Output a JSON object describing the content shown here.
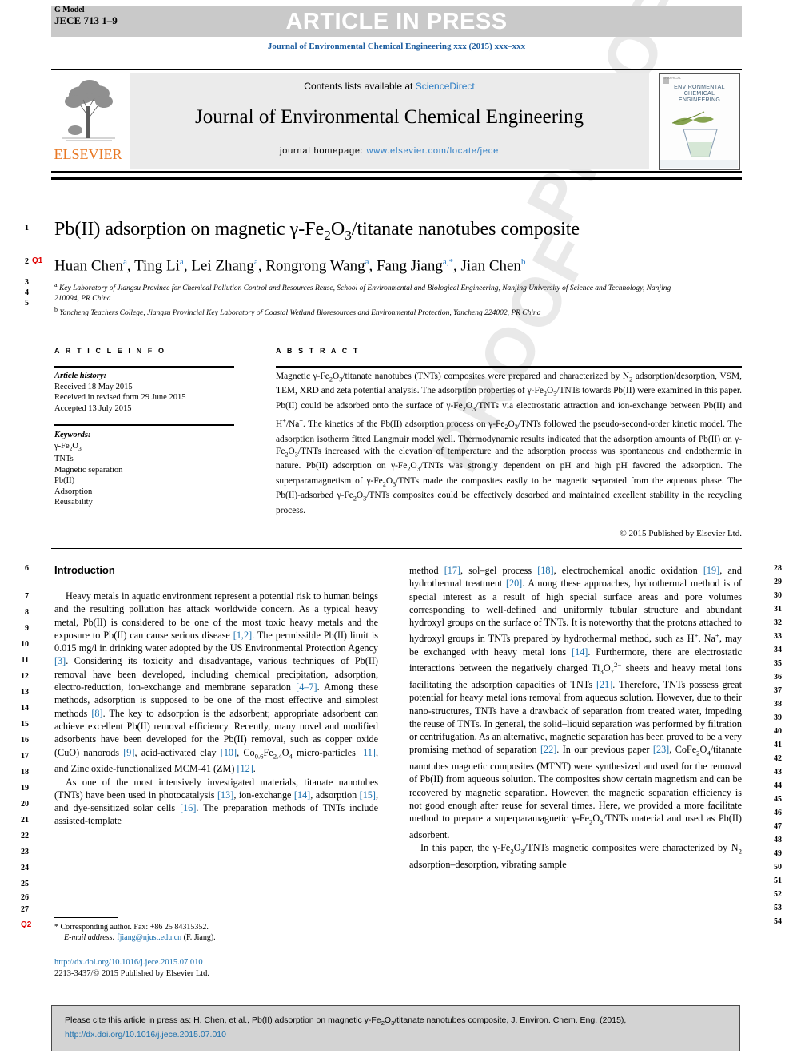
{
  "header": {
    "g_model_line1": "G Model",
    "g_model_line2": "JECE 713 1–9",
    "article_in_press": "ARTICLE IN PRESS",
    "journal_ref_line": "Journal of Environmental Chemical Engineering xxx (2015) xxx–xxx"
  },
  "masthead": {
    "contents_prefix": "Contents lists available at ",
    "sciencedirect": "ScienceDirect",
    "journal_title": "Journal of Environmental Chemical Engineering",
    "homepage_label": "journal homepage: ",
    "homepage_url": "www.elsevier.com/locate/jece",
    "publisher_wordmark": "ELSEVIER",
    "cover_title_line1": "ENVIRONMENTAL",
    "cover_title_line2": "CHEMICAL",
    "cover_title_line3": "ENGINEERING",
    "cover_micro_label": "GRAPHICAL"
  },
  "article": {
    "title_html": "Pb(II) adsorption on magnetic &gamma;-Fe<sub>2</sub>O<sub>3</sub>/titanate nanotubes composite",
    "authors_html": "Huan Chen<sup>a</sup>, Ting Li<sup>a</sup>, Lei Zhang<sup>a</sup>, Rongrong Wang<sup>a</sup>, Fang Jiang<sup>a,*</sup>, Jian Chen<sup>b</sup>",
    "affiliation_a_html": "<sup>a</sup> Key Laboratory of Jiangsu Province for Chemical Pollution Control and Resources Reuse, School of Environmental and Biological Engineering, Nanjing University of Science and Technology, Nanjing 210094, PR China",
    "affiliation_b_html": "<sup>b</sup> Yancheng Teachers College, Jiangsu Provincial Key Laboratory of Coastal Wetland Bioresources and Environmental Protection, Yancheng 224002, PR China"
  },
  "info": {
    "heading": "A R T I C L E   I N F O",
    "history_label": "Article history:",
    "history": [
      "Received 18 May 2015",
      "Received in revised form 29 June 2015",
      "Accepted 13 July 2015"
    ],
    "keywords_label": "Keywords:",
    "keywords_html": [
      "&gamma;-Fe<sub>2</sub>O<sub>3</sub>",
      "TNTs",
      "Magnetic separation",
      "Pb(II)",
      "Adsorption",
      "Reusability"
    ]
  },
  "abstract": {
    "heading": "A B S T R A C T",
    "body_html": "Magnetic &gamma;-Fe<sub>2</sub>O<sub>3</sub>/titanate nanotubes (TNTs) composites were prepared and characterized by N<sub>2</sub> adsorption/desorption, VSM, TEM, XRD and zeta potential analysis. The adsorption properties of &gamma;-Fe<sub>2</sub>O<sub>3</sub>/TNTs towards Pb(II) were examined in this paper. Pb(II) could be adsorbed onto the surface of &gamma;-Fe<sub>2</sub>O<sub>3</sub>/TNTs via electrostatic attraction and ion-exchange between Pb(II) and H<sup>+</sup>/Na<sup>+</sup>. The kinetics of the Pb(II) adsorption process on &gamma;-Fe<sub>2</sub>O<sub>3</sub>/TNTs followed the pseudo-second-order kinetic model. The adsorption isotherm fitted Langmuir model well. Thermodynamic results indicated that the adsorption amounts of Pb(II) on &gamma;-Fe<sub>2</sub>O<sub>3</sub>/TNTs increased with the elevation of temperature and the adsorption process was spontaneous and endothermic in nature. Pb(II) adsorption on &gamma;-Fe<sub>2</sub>O<sub>3</sub>/TNTs was strongly dependent on pH and high pH favored the adsorption. The superparamagnetism of &gamma;-Fe<sub>2</sub>O<sub>3</sub>/TNTs made the composites easily to be magnetic separated from the aqueous phase. The Pb(II)-adsorbed &gamma;-Fe<sub>2</sub>O<sub>3</sub>/TNTs composites could be effectively desorbed and maintained excellent stability in the recycling process.",
    "copyright": "© 2015 Published by Elsevier Ltd."
  },
  "body": {
    "intro_heading": "Introduction",
    "left_col_html": "<span class=\"indent\">Heavy metals in aquatic environment represent a potential risk to human beings and the resulting pollution has attack worldwide concern. As a typical heavy metal, Pb(II) is considered to be one of the most toxic heavy metals and the exposure to Pb(II) can cause serious disease <span class=\"ref\">[1,2]</span>. The permissible Pb(II) limit is 0.015 mg/l in drinking water adopted by the US Environmental Protection Agency <span class=\"ref\">[3]</span>. Considering its toxicity and disadvantage, various techniques of Pb(II) removal have been developed, including chemical precipitation, adsorption, electro-reduction, ion-exchange and membrane separation <span class=\"ref\">[4&ndash;7]</span>. Among these methods, adsorption is supposed to be one of the most effective and simplest methods <span class=\"ref\">[8]</span>. The key to adsorption is the adsorbent; appropriate adsorbent can achieve excellent Pb(II) removal efficiency. Recently, many novel and modified adsorbents have been developed for the Pb(II) removal, such as copper oxide (CuO) nanorods <span class=\"ref\">[9]</span>, acid-activated clay <span class=\"ref\">[10]</span>, Co<sub>0.6</sub>Fe<sub>2.4</sub>O<sub>4</sub> micro-particles <span class=\"ref\">[11]</span>, and Zinc oxide-functionalized MCM-41 (ZM) <span class=\"ref\">[12]</span>.</span><span class=\"indent\">As one of the most intensively investigated materials, titanate nanotubes (TNTs) have been used in photocatalysis <span class=\"ref\">[13]</span>, ion-exchange <span class=\"ref\">[14]</span>, adsorption <span class=\"ref\">[15]</span>, and dye-sensitized solar cells <span class=\"ref\">[16]</span>. The preparation methods of TNTs include assisted-template</span>",
    "right_col_html": "method <span class=\"ref\">[17]</span>, sol&ndash;gel process <span class=\"ref\">[18]</span>, electrochemical anodic oxidation <span class=\"ref\">[19]</span>, and hydrothermal treatment <span class=\"ref\">[20]</span>. Among these approaches, hydrothermal method is of special interest as a result of high special surface areas and pore volumes corresponding to well-defined and uniformly tubular structure and abundant hydroxyl groups on the surface of TNTs. It is noteworthy that the protons attached to hydroxyl groups in TNTs prepared by hydrothermal method, such as H<sup>+</sup>, Na<sup>+</sup>, may be exchanged with heavy metal ions <span class=\"ref\">[14]</span>. Furthermore, there are electrostatic interactions between the negatively charged Ti<sub>3</sub>O<sub>7</sub><sup>2&minus;</sup> sheets and heavy metal ions facilitating the adsorption capacities of TNTs <span class=\"ref\">[21]</span>. Therefore, TNTs possess great potential for heavy metal ions removal from aqueous solution. However, due to their nano-structures, TNTs have a drawback of separation from treated water, impeding the reuse of TNTs. In general, the solid&ndash;liquid separation was performed by filtration or centrifugation. As an alternative, magnetic separation has been proved to be a very promising method of separation <span class=\"ref\">[22]</span>. In our previous paper <span class=\"ref\">[23]</span>, CoFe<sub>2</sub>O<sub>4</sub>/titanate nanotubes magnetic composites (MTNT) were synthesized and used for the removal of Pb(II) from aqueous solution. The composites show certain magnetism and can be recovered by magnetic separation. However, the magnetic separation efficiency is not good enough after reuse for several times. Here, we provided a more facilitate method to prepare a superparamagnetic &gamma;-Fe<sub>2</sub>O<sub>3</sub>/TNTs material and used as Pb(II) adsorbent.<span class=\"indent\">In this paper, the &gamma;-Fe<sub>2</sub>O<sub>3</sub>/TNTs magnetic composites were characterized by N<sub>2</sub> adsorption&ndash;desorption, vibrating sample</span>"
  },
  "footnote": {
    "corresponding_html": "* Corresponding author. Fax: +86 25 84315352.",
    "email_label": "E-mail address:",
    "email": "fjiang@njust.edu.cn",
    "email_owner": "(F. Jiang).",
    "doi_url": "http://dx.doi.org/10.1016/j.jece.2015.07.010",
    "issn_line": "2213-3437/© 2015 Published by Elsevier Ltd."
  },
  "cite_box": {
    "text_html": "Please cite this article in press as: H. Chen, et al., Pb(II) adsorption on magnetic &gamma;-Fe<sub>2</sub>O<sub>3</sub>/titanate nanotubes composite, J. Environ. Chem. Eng. (2015), ",
    "link": "http://dx.doi.org/10.1016/j.jece.2015.07.010"
  },
  "line_numbers": {
    "title_block": [
      "1",
      "2",
      "3",
      "4",
      "5"
    ],
    "left_column": [
      "6",
      "7",
      "8",
      "9",
      "10",
      "11",
      "12",
      "13",
      "14",
      "15",
      "16",
      "17",
      "18",
      "19",
      "20",
      "21",
      "22",
      "23",
      "24",
      "25",
      "26",
      "27"
    ],
    "right_column": [
      "28",
      "29",
      "30",
      "31",
      "32",
      "33",
      "34",
      "35",
      "36",
      "37",
      "38",
      "39",
      "40",
      "41",
      "42",
      "43",
      "44",
      "45",
      "46",
      "47",
      "48",
      "49",
      "50",
      "51",
      "52",
      "53",
      "54"
    ]
  },
  "query_tags": {
    "q1": "Q1",
    "q2": "Q2"
  },
  "watermark": {
    "text": "PROOF"
  },
  "colors": {
    "link": "#1a6fad",
    "elsevier_orange": "#E87722",
    "press_bar": "#c9c9c9",
    "query_red": "#e00000"
  }
}
